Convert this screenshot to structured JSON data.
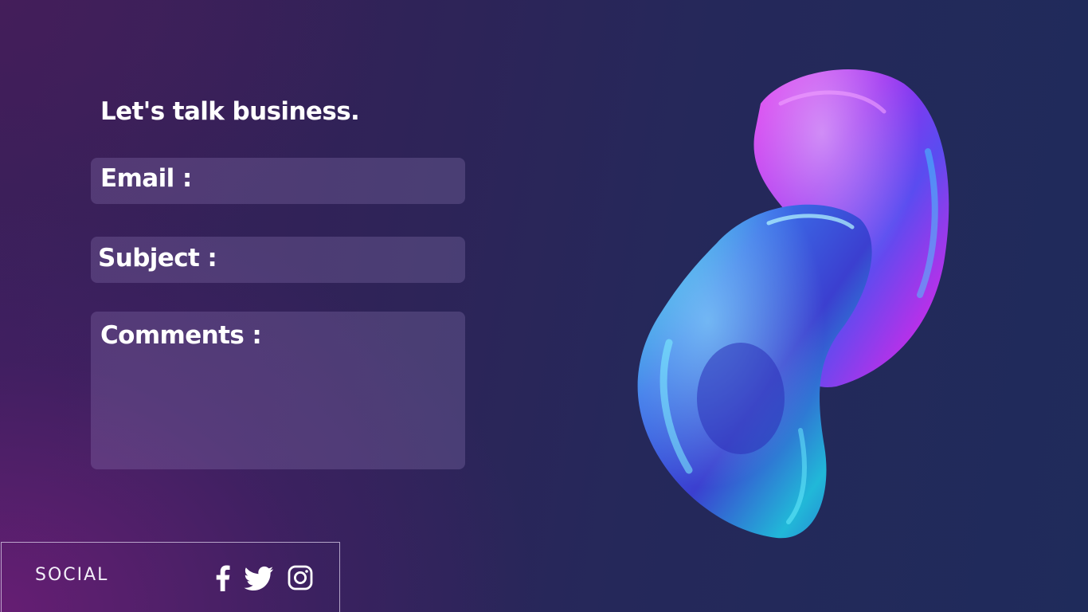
{
  "contact": {
    "headline": "Let's talk business.",
    "email_label": "Email :",
    "email_value": "",
    "subject_label": "Subject :",
    "subject_value": "",
    "comments_label": "Comments :",
    "comments_value": ""
  },
  "social": {
    "label": "SOCIAL",
    "icons": [
      "facebook-icon",
      "twitter-icon",
      "instagram-icon"
    ]
  },
  "colors": {
    "text": "#ffffff",
    "field_background": "rgba(150,130,190,0.28)",
    "background_left": "#3a1f5a",
    "background_right": "#1f2b5b",
    "blob_magenta": "#c02ee8",
    "blob_cyan": "#22d6e0",
    "blob_blue": "#3b3fd0"
  }
}
